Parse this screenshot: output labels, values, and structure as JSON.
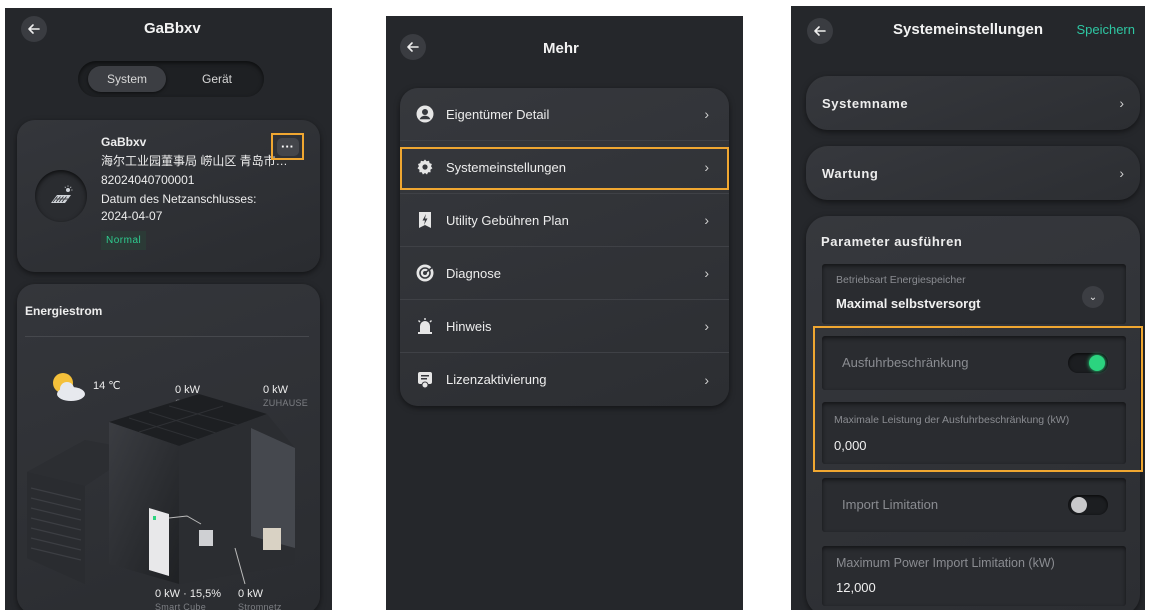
{
  "screen1": {
    "title": "GaBbxv",
    "tabs": [
      "System",
      "Gerät"
    ],
    "device": {
      "name": "GaBbxv",
      "address": "海尔工业园董事局 崂山区 青岛市 山东省 中国",
      "serial": "82024040700001",
      "grid_date_label": "Datum des Netzanschlusses:",
      "grid_date": "2024-04-07",
      "status": "Normal"
    },
    "more_label": "···",
    "energy_title": "Energiestrom",
    "temperature": "14 ℃",
    "solar_value": "0 kW",
    "solar_label": "SOLAR",
    "home_value": "0 kW",
    "home_label": "ZUHAUSE",
    "battery_value": "0 kW · 15,5%",
    "battery_label": "Smart Cube",
    "grid_value": "0 kW",
    "grid_label": "Stromnetz"
  },
  "screen2": {
    "title": "Mehr",
    "items": [
      {
        "label": "Eigentümer Detail",
        "icon": "user-icon"
      },
      {
        "label": "Systemeinstellungen",
        "icon": "gear-icon"
      },
      {
        "label": "Utility Gebühren Plan",
        "icon": "bolt-icon"
      },
      {
        "label": "Diagnose",
        "icon": "diagnose-icon"
      },
      {
        "label": "Hinweis",
        "icon": "alarm-icon"
      },
      {
        "label": "Lizenzaktivierung",
        "icon": "license-icon"
      }
    ]
  },
  "screen3": {
    "title": "Systemeinstellungen",
    "save_label": "Speichern",
    "system_name_label": "Systemname",
    "maintenance_label": "Wartung",
    "params_title": "Parameter ausführen",
    "mode_label": "Betriebsart Energiespeicher",
    "mode_value": "Maximal selbstversorgt",
    "export_limit_label": "Ausfuhrbeschränkung",
    "export_limit_on": true,
    "export_max_label": "Maximale Leistung der Ausfuhrbeschränkung (kW)",
    "export_max_value": "0,000",
    "import_limit_label": "Import Limitation",
    "import_limit_on": false,
    "import_max_label": "Maximum Power Import Limitation (kW)",
    "import_max_value": "12,000"
  },
  "colors": {
    "accent": "#f0a731",
    "toggle_on": "#2bd47f",
    "save": "#2ec7a3",
    "status": "#2ecc8f"
  }
}
